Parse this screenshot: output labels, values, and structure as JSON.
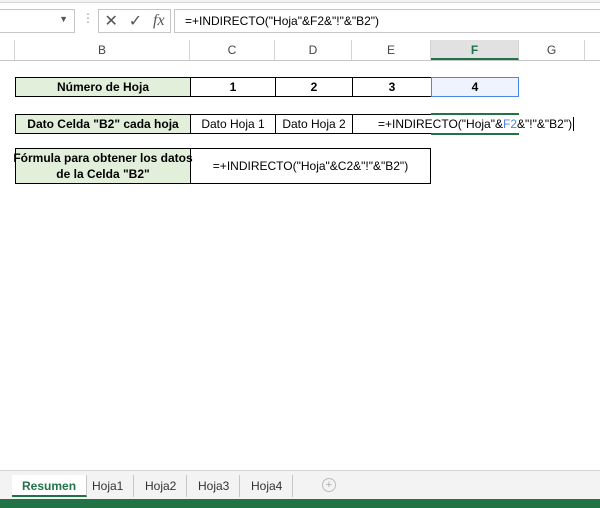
{
  "formula_bar": {
    "name_box": "",
    "cancel_icon": "✕",
    "enter_icon": "✓",
    "fx_label": "fx",
    "formula": "=+INDIRECTO(\"Hoja\"&F2&\"!\"&\"B2\")"
  },
  "columns": [
    "B",
    "C",
    "D",
    "E",
    "F",
    "G"
  ],
  "selected_column": "F",
  "row1": {
    "label": "Número de Hoja",
    "values": [
      "1",
      "2",
      "3",
      "4"
    ]
  },
  "row2": {
    "label": "Dato Celda \"B2\" cada hoja",
    "values": [
      "Dato Hoja 1",
      "Dato Hoja 2"
    ],
    "editing_pre": "=+INDIRECTO(\"Hoja\"&",
    "editing_ref": "F2",
    "editing_post": "&\"!\"&\"B2\")"
  },
  "row3": {
    "label_line1": "Fórmula para obtener los datos",
    "label_line2": "de la Celda \"B2\"",
    "formula": "=+INDIRECTO(\"Hoja\"&C2&\"!\"&\"B2\")"
  },
  "sheet_tabs": [
    {
      "label": "Resumen",
      "active": true
    },
    {
      "label": "Hoja1"
    },
    {
      "label": "Hoja2"
    },
    {
      "label": "Hoja3"
    },
    {
      "label": "Hoja4"
    }
  ],
  "colors": {
    "accent": "#217346",
    "label_fill": "#e2efda",
    "ref_blue": "#4a86e8"
  }
}
